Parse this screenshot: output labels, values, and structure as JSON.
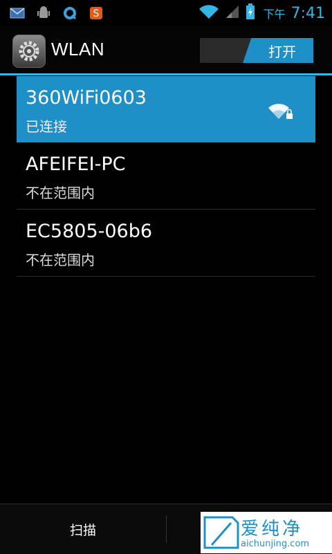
{
  "statusbar": {
    "left_icons": [
      "mail-icon",
      "android-debug-icon",
      "q-app-icon",
      "s-app-icon"
    ],
    "ampm": "下午",
    "time": "7:41"
  },
  "header": {
    "title": "WLAN",
    "toggle_label": "打开"
  },
  "networks": [
    {
      "name": "360WiFi0603",
      "status": "已连接",
      "connected": true
    },
    {
      "name": "AFEIFEI-PC",
      "status": "不在范围内",
      "connected": false
    },
    {
      "name": "EC5805-06b6",
      "status": "不在范围内",
      "connected": false
    }
  ],
  "bottom": {
    "scan_label": "扫描"
  },
  "watermark": {
    "text": "爱纯净",
    "url": "aichunjing.com"
  },
  "colors": {
    "accent": "#33b5e5",
    "selected": "#1e8fc7"
  }
}
